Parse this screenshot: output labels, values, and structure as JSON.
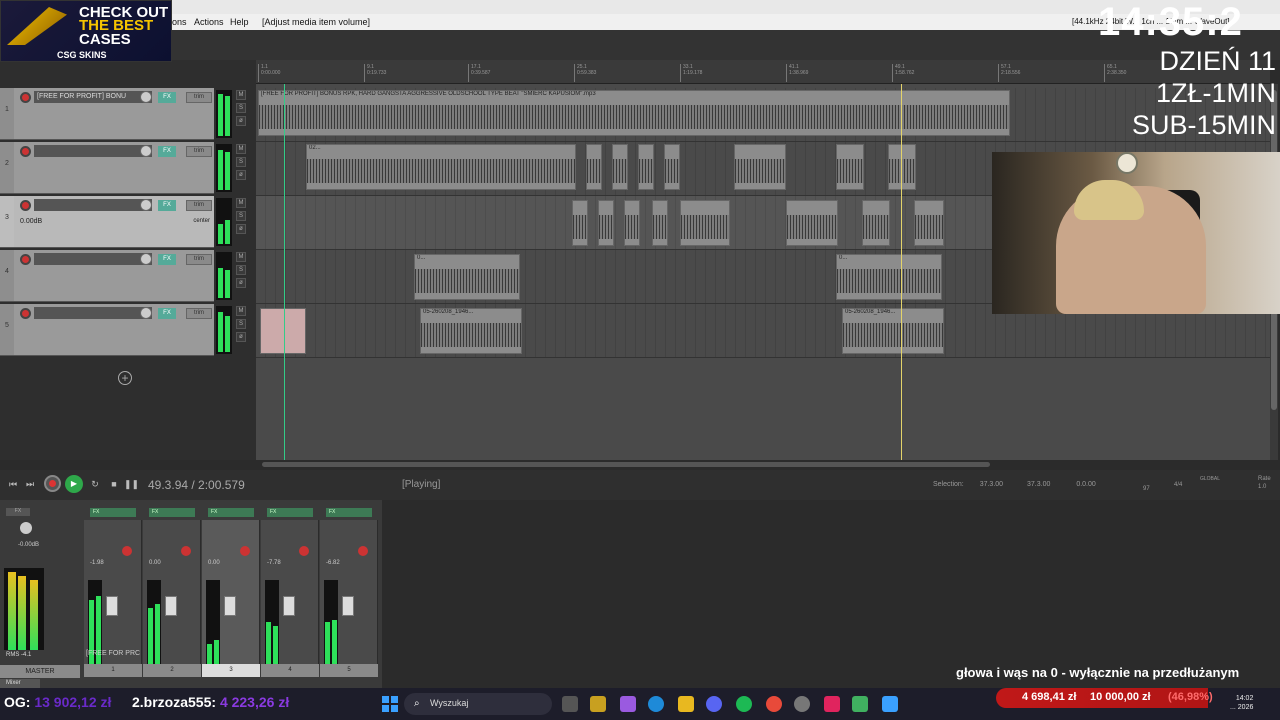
{
  "menu": {
    "items": [
      "ons",
      "Actions",
      "Help"
    ],
    "action_text": "[Adjust media item volume]",
    "status_right": "[44.1kHz 24bit W... 1ch ... 18/m ... WaveOut]"
  },
  "sponsor": {
    "line1": "CHECK OUT",
    "line2": "THE BEST",
    "line3": "CASES",
    "brand": "CSG SKINS"
  },
  "overlay": {
    "clock": "14:35:2",
    "day": "DZIEŃ 11",
    "rate": "1ZŁ-1MIN",
    "sub": "SUB-15MIN",
    "ticker": "głowa i wąs na 0 - wyłącznie na przedłużanym"
  },
  "ruler": {
    "marks": [
      {
        "bar": "1.1",
        "time": "0:00.000"
      },
      {
        "bar": "9.1",
        "time": "0:19.733"
      },
      {
        "bar": "17.1",
        "time": "0:39.587"
      },
      {
        "bar": "25.1",
        "time": "0:59.383"
      },
      {
        "bar": "33.1",
        "time": "1:19.178"
      },
      {
        "bar": "41.1",
        "time": "1:38.969"
      },
      {
        "bar": "49.1",
        "time": "1:58.762"
      },
      {
        "bar": "57.1",
        "time": "2:18.556"
      },
      {
        "bar": "65.1",
        "time": "2:38.350"
      }
    ]
  },
  "tracks": [
    {
      "num": "1",
      "name": "[FREE FOR PROFIT] BONU",
      "fx": "FX",
      "trim": "trim",
      "vol": "",
      "pan": ""
    },
    {
      "num": "2",
      "name": "",
      "fx": "FX",
      "trim": "trim",
      "vol": "",
      "pan": ""
    },
    {
      "num": "3",
      "name": "",
      "fx": "FX",
      "trim": "trim",
      "vol": "0.00dB",
      "pan": "center"
    },
    {
      "num": "4",
      "name": "",
      "fx": "FX",
      "trim": "trim",
      "vol": "",
      "pan": ""
    },
    {
      "num": "5",
      "name": "",
      "fx": "FX",
      "trim": "trim",
      "vol": "",
      "pan": ""
    }
  ],
  "items": {
    "beat_title": "[FREE FOR PROFIT] BONUS RPK, HARD GANGSTA AGGRESSIVE OLDSCHOOL TYPE BEAT \"ŚMIERĆ KAPUSIOM\".mp3",
    "t2_title": "02...",
    "t4_title": "0...",
    "t5_title": "05-260208_1946..."
  },
  "transport": {
    "position": "49.3.94 / 2:00.579",
    "state": "[Playing]",
    "selection_label": "Selection:",
    "sel_start": "37.3.00",
    "sel_end": "37.3.00",
    "sel_len": "0.0.00",
    "bpm": "97",
    "timesig": "4/4",
    "global": "GLOBAL",
    "rate_label": "Rate",
    "rate_value": "1.0"
  },
  "mixer": {
    "master_label": "MASTER",
    "master_db": "-0.00dB",
    "rms": "RMS",
    "rms_val": "-4.1",
    "mixer_tab": "Mixer",
    "strip_name": "[FREE FOR PRC",
    "strips": [
      {
        "label": "1",
        "db": "-1.98"
      },
      {
        "label": "2",
        "db": "0.00"
      },
      {
        "label": "3",
        "db": "0.00"
      },
      {
        "label": "4",
        "db": "-7.78"
      },
      {
        "label": "5",
        "db": "-6.82"
      }
    ]
  },
  "taskbar": {
    "og_label": "OG:",
    "og_amount": "13 902,12 zł",
    "brz_label": "2.brzoza555:",
    "brz_amount": "4 223,26 zł",
    "search": "Wyszukaj",
    "goal_current": "4 698,41 zł",
    "goal_target": "10 000,00 zł",
    "goal_pct": "(46,98%)",
    "time": "14:02",
    "date": "... 2026"
  },
  "colors": {
    "accent_green": "#2ee05a",
    "record_red": "#cc3333",
    "play_cursor": "#e3d36a",
    "goal_red": "#c01818"
  }
}
